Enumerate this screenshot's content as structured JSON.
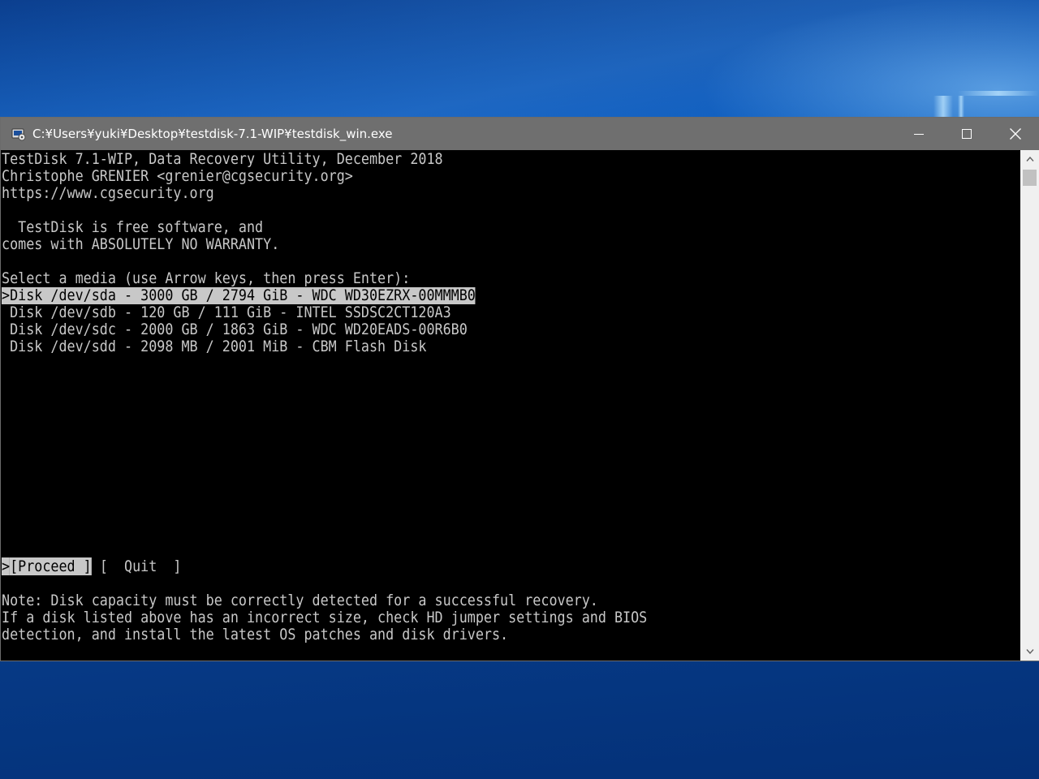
{
  "window": {
    "title": "C:¥Users¥yuki¥Desktop¥testdisk-7.1-WIP¥testdisk_win.exe",
    "icon": "console-app-icon",
    "controls": [
      "minimize-icon",
      "maximize-icon",
      "close-icon"
    ]
  },
  "console": {
    "header": [
      "TestDisk 7.1-WIP, Data Recovery Utility, December 2018",
      "Christophe GRENIER <grenier@cgsecurity.org>",
      "https://www.cgsecurity.org"
    ],
    "license": [
      "  TestDisk is free software, and",
      "comes with ABSOLUTELY NO WARRANTY."
    ],
    "prompt": "Select a media (use Arrow keys, then press Enter):",
    "disks": [
      ">Disk /dev/sda - 3000 GB / 2794 GiB - WDC WD30EZRX-00MMMB0",
      " Disk /dev/sdb - 120 GB / 111 GiB - INTEL SSDSC2CT120A3",
      " Disk /dev/sdc - 2000 GB / 1863 GiB - WDC WD20EADS-00R6B0",
      " Disk /dev/sdd - 2098 MB / 2001 MiB - CBM Flash Disk"
    ],
    "selected_disk_index": 0,
    "actions": {
      "cursor": ">",
      "proceed": "[Proceed ]",
      "quit": "[  Quit  ]"
    },
    "note": [
      "Note: Disk capacity must be correctly detected for a successful recovery.",
      "If a disk listed above has an incorrect size, check HD jumper settings and BIOS",
      "detection, and install the latest OS patches and disk drivers."
    ]
  },
  "scrollbar": {
    "up_icon": "scroll-up-arrow-icon",
    "down_icon": "scroll-down-arrow-icon"
  },
  "colors": {
    "console_bg": "#000000",
    "console_fg": "#c8c8c8",
    "highlight_bg": "#c8c8c8",
    "titlebar_bg": "#6f6f6f",
    "desktop_blue": "#0a56b8"
  }
}
